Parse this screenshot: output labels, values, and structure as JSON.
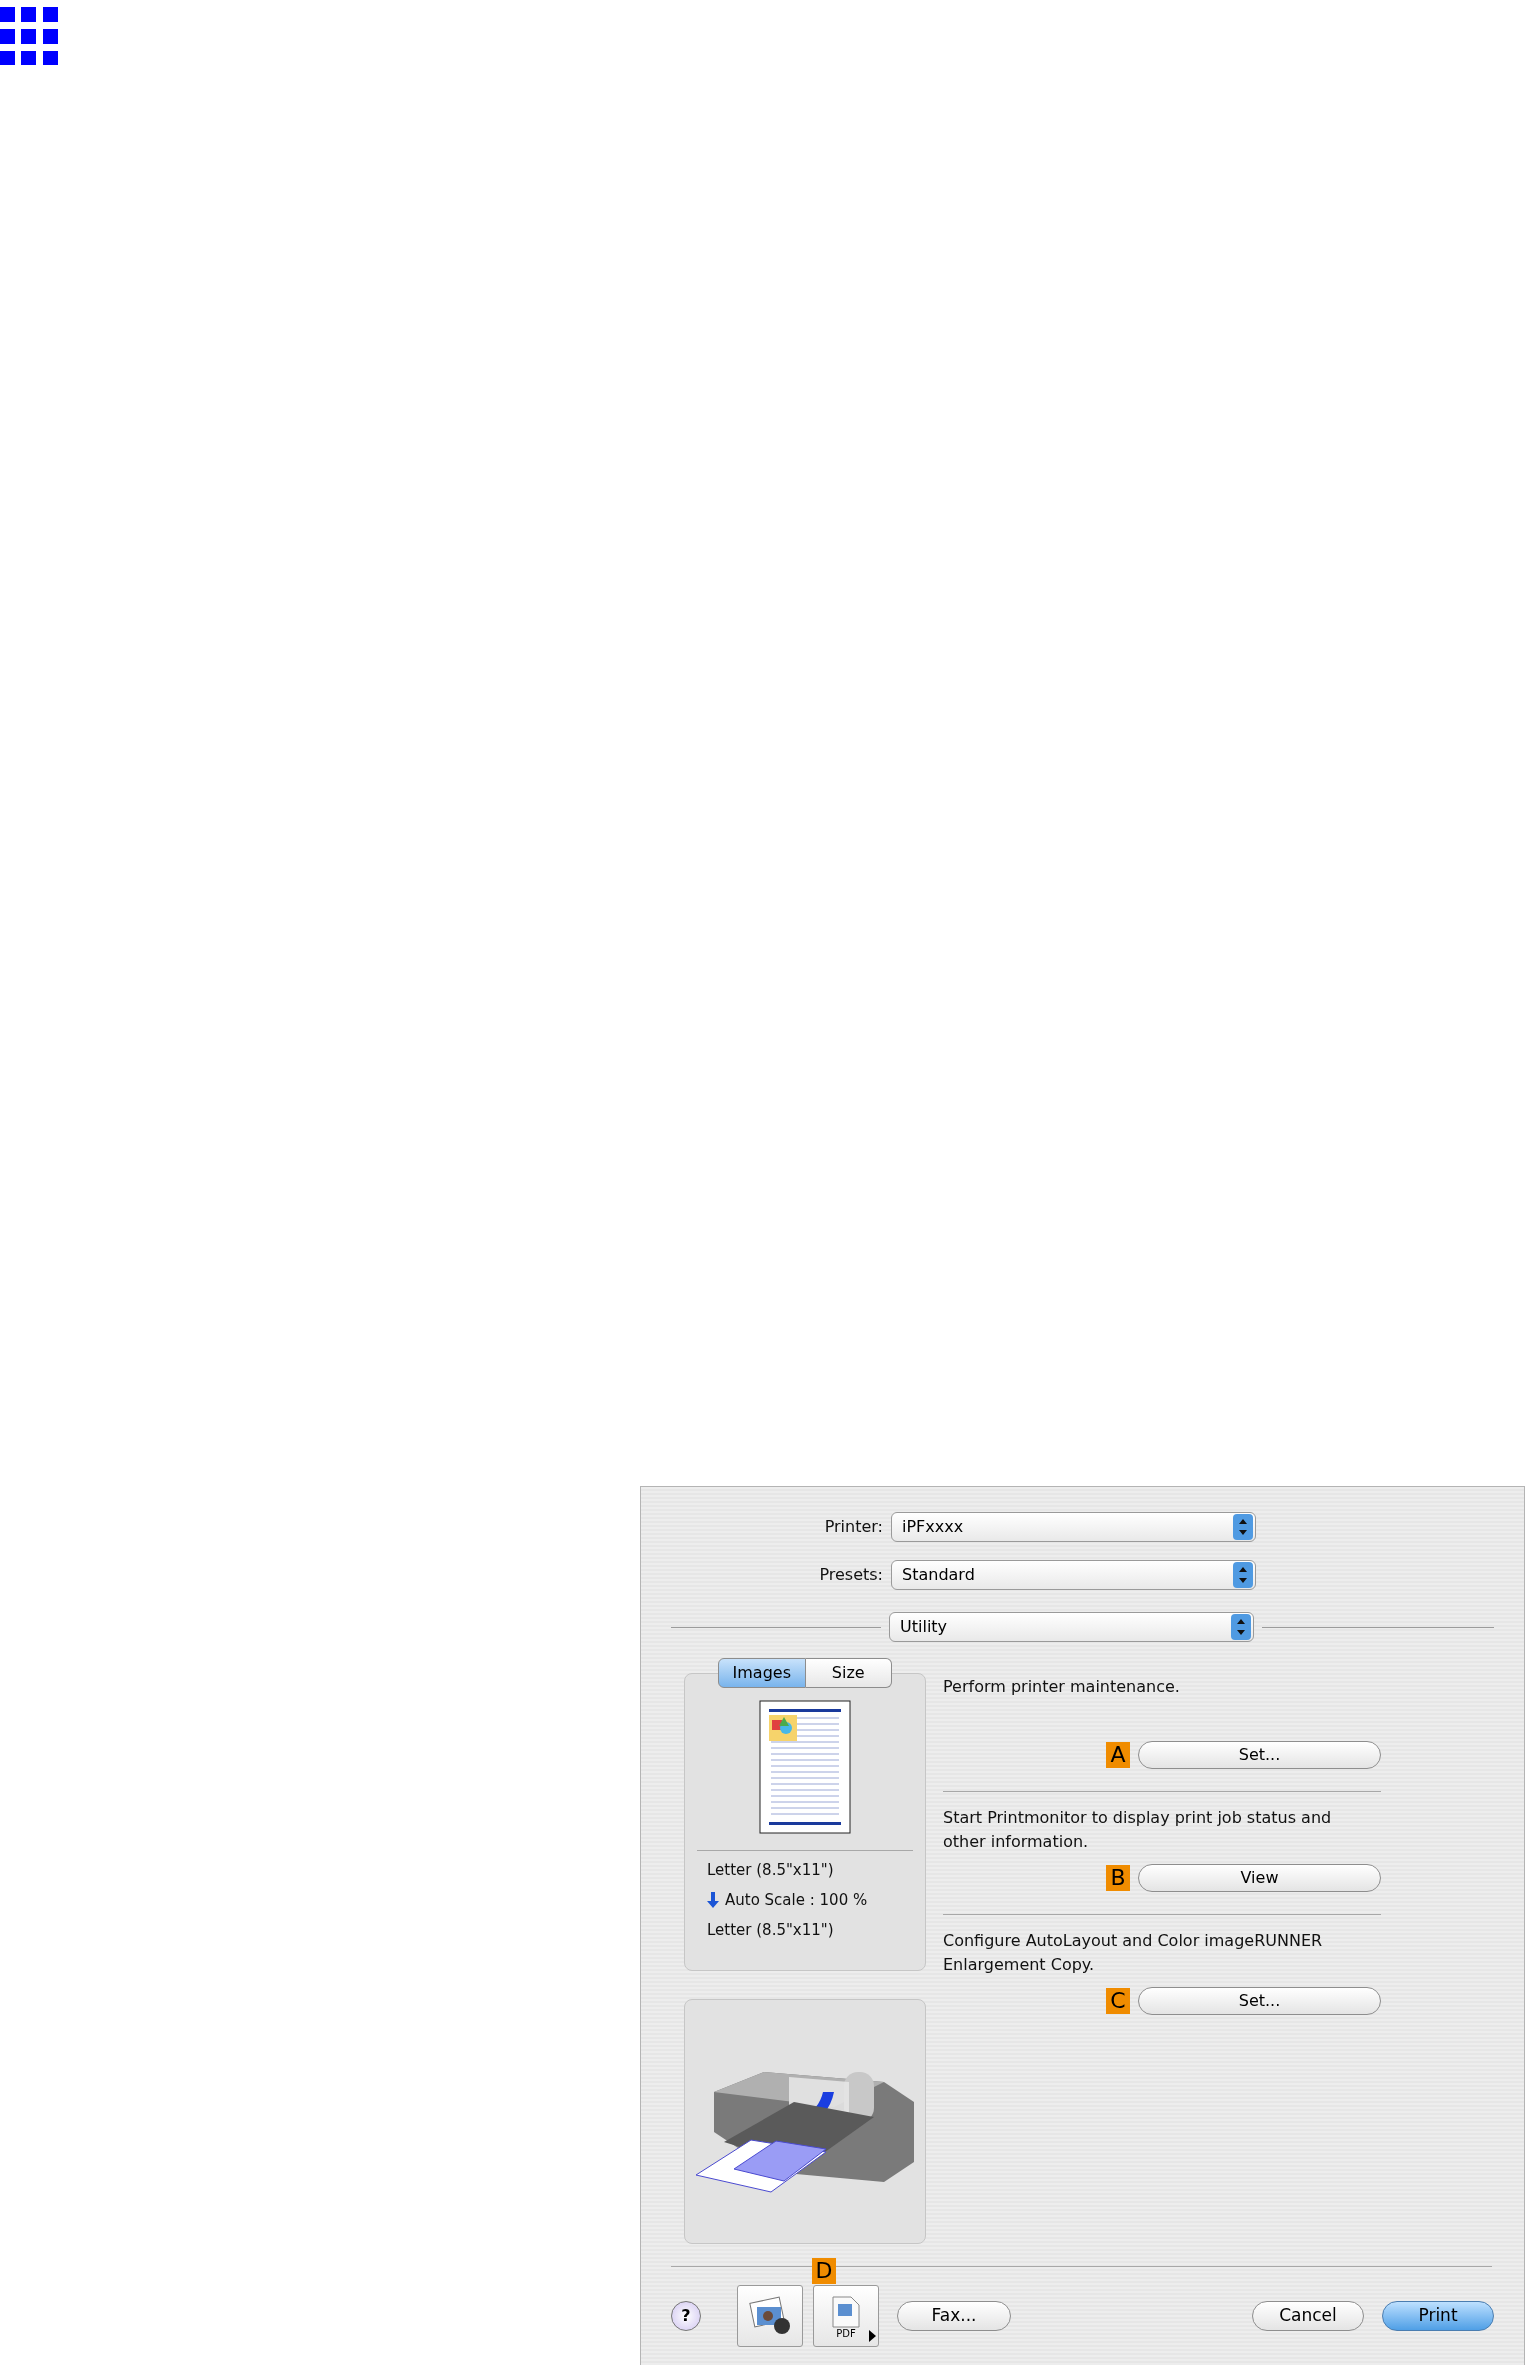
{
  "dialog": {
    "printer": {
      "label": "Printer:",
      "value": "iPFxxxx"
    },
    "presets": {
      "label": "Presets:",
      "value": "Standard"
    },
    "panel_menu": {
      "value": "Utility"
    },
    "preview_tabs": [
      {
        "label": "Images",
        "selected": true
      },
      {
        "label": "Size",
        "selected": false
      }
    ],
    "preview_info": [
      {
        "kind": "size",
        "text": "Letter (8.5\"x11\")"
      },
      {
        "kind": "scale",
        "text": "Auto Scale : 100 %"
      },
      {
        "kind": "size",
        "text": "Letter (8.5\"x11\")"
      }
    ],
    "utility_items": [
      {
        "description": "Perform printer maintenance.",
        "marker": "A",
        "button": "Set..."
      },
      {
        "description": "Start Printmonitor to display print job status and other information.",
        "marker": "B",
        "button": "View"
      },
      {
        "description": "Configure AutoLayout and Color imageRUNNER Enlargement Copy.",
        "marker": "C",
        "button": "Set..."
      }
    ],
    "help": "?",
    "marker": "D",
    "pdf_label": "PDF",
    "left_buttons": [
      {
        "label": "Fax...",
        "default": false
      }
    ],
    "right_buttons": [
      {
        "label": "Cancel",
        "default": false
      },
      {
        "label": "Print",
        "default": true
      }
    ]
  }
}
